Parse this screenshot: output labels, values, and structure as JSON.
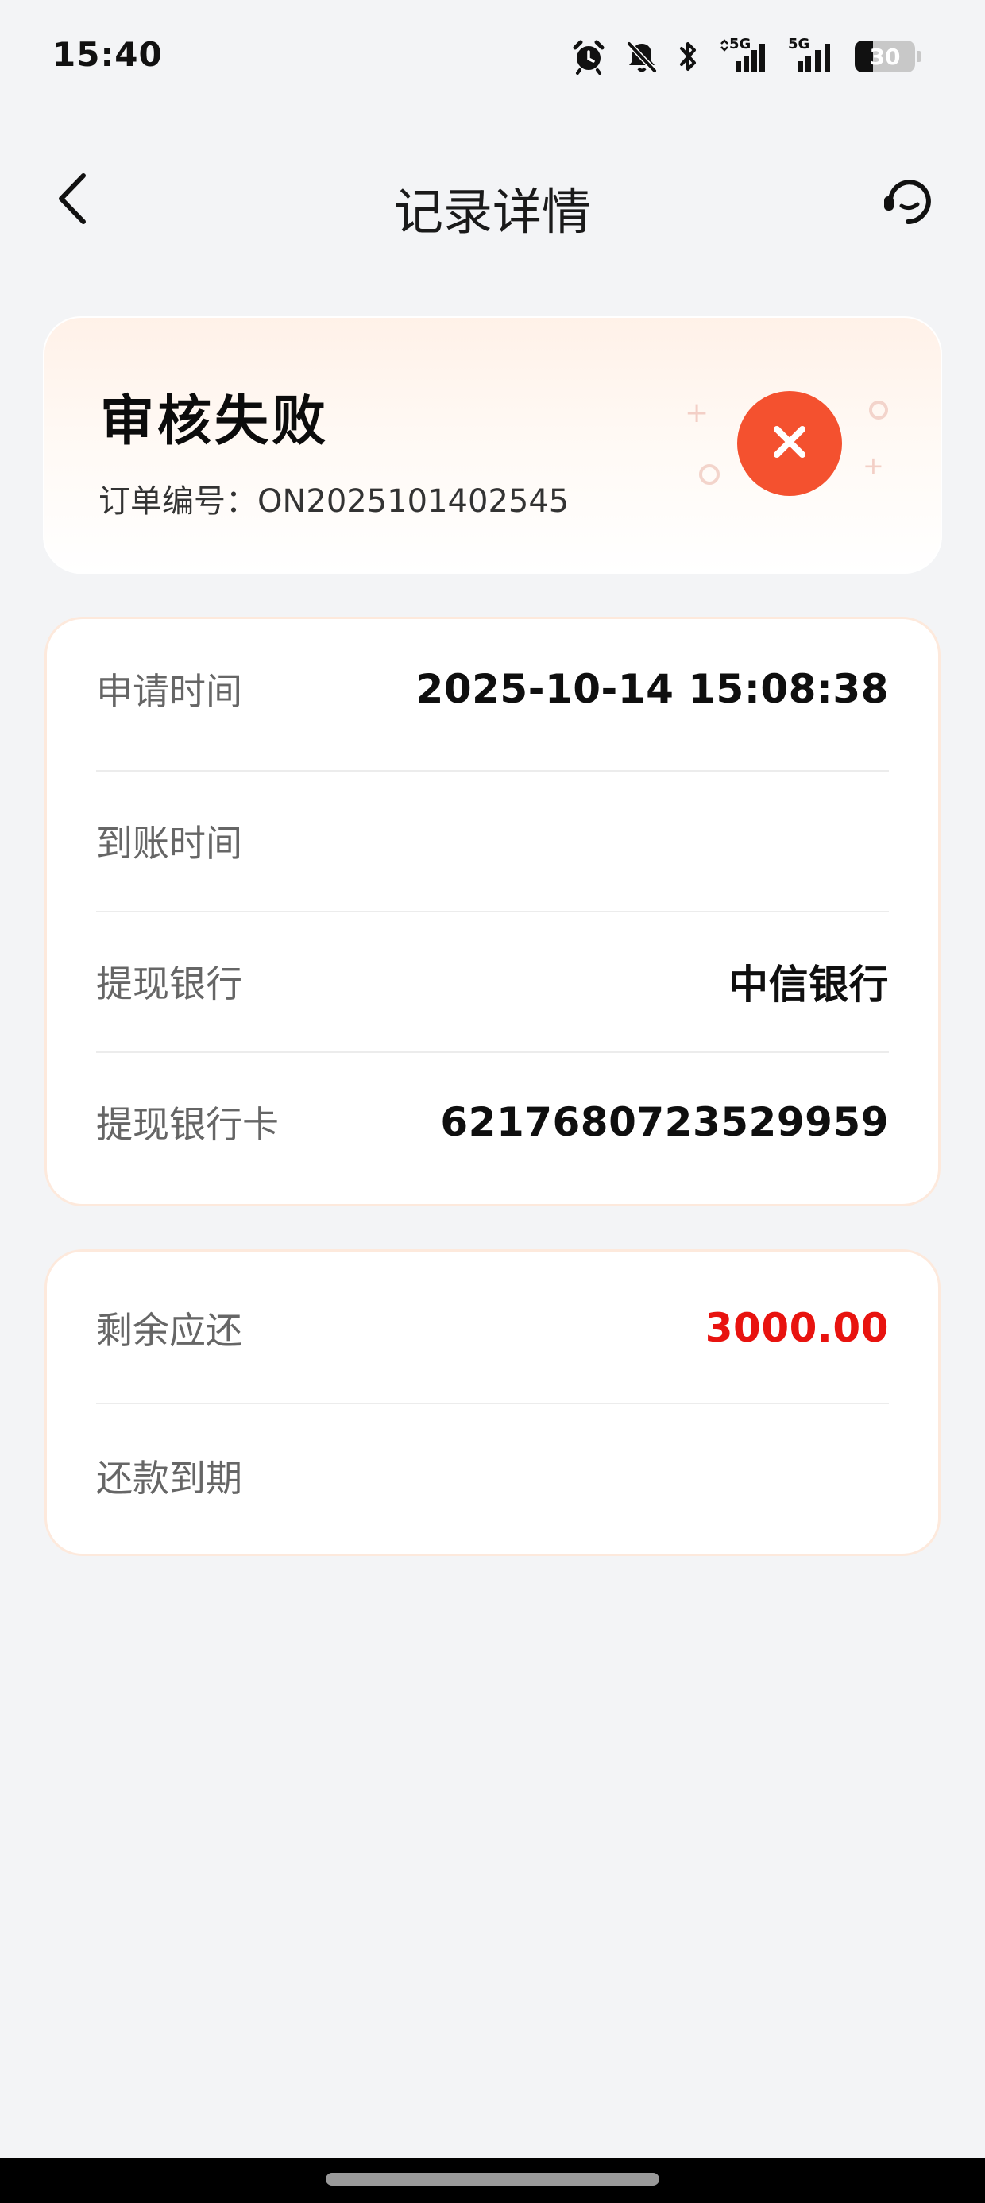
{
  "status_bar": {
    "time": "15:40",
    "signal1_label": "5G",
    "signal2_label": "5G",
    "battery_percent": "30",
    "battery_level": 0.3,
    "icons": [
      "alarm-icon",
      "bell-off-icon",
      "bluetooth-icon",
      "signal-icon",
      "signal-icon",
      "battery-icon"
    ]
  },
  "header": {
    "title": "记录详情",
    "back_icon": "chevron-left-icon",
    "support_icon": "customer-service-icon"
  },
  "status_card": {
    "title": "审核失败",
    "order_label": "订单编号：",
    "order_number": "ON2025101402545",
    "badge_icon": "close-icon",
    "badge_color": "#f4512f"
  },
  "details": {
    "rows": [
      {
        "label": "申请时间",
        "value": "2025-10-14 15:08:38"
      },
      {
        "label": "到账时间",
        "value": ""
      },
      {
        "label": "提现银行",
        "value": "中信银行"
      },
      {
        "label": "提现银行卡",
        "value": "6217680723529959"
      }
    ]
  },
  "repayment": {
    "rows": [
      {
        "label": "剩余应还",
        "value": "3000.00",
        "value_color": "#e8130f"
      },
      {
        "label": "还款到期",
        "value": ""
      }
    ]
  }
}
